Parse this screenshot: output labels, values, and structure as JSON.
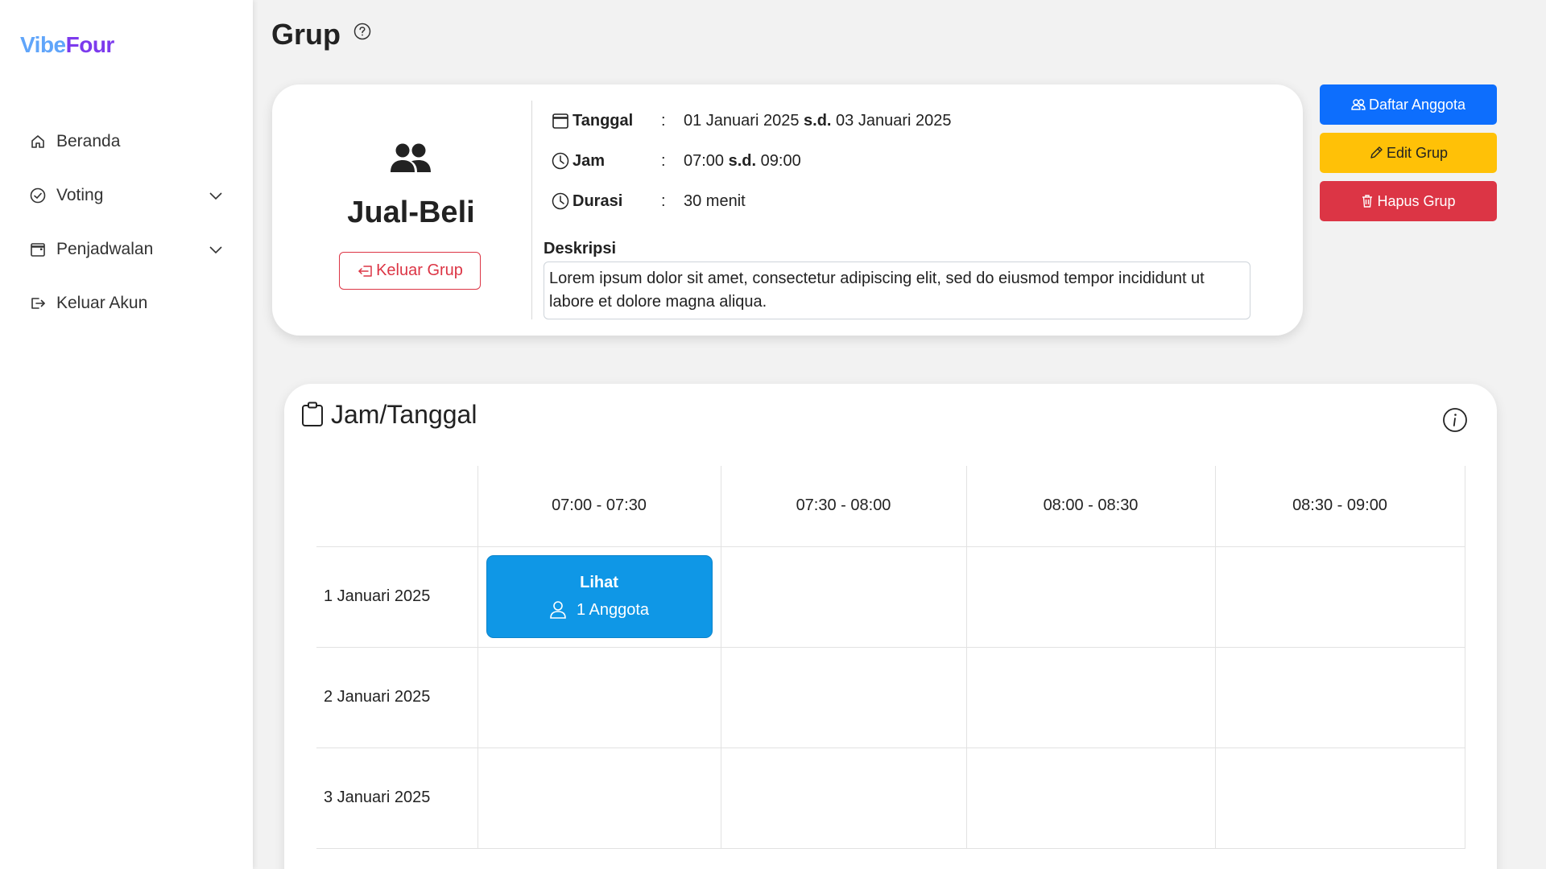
{
  "app": {
    "logo_part1": "Vibe",
    "logo_part2": "Four"
  },
  "sidebar": {
    "items": [
      {
        "label": "Beranda",
        "icon": "home-icon"
      },
      {
        "label": "Voting",
        "icon": "check-circle-icon",
        "has_dropdown": true
      },
      {
        "label": "Penjadwalan",
        "icon": "calendar-icon",
        "has_dropdown": true
      },
      {
        "label": "Keluar Akun",
        "icon": "logout-icon"
      }
    ]
  },
  "page": {
    "title": "Grup",
    "help_icon": "question-circle-icon"
  },
  "group": {
    "name": "Jual-Beli",
    "leave_label": "Keluar Grup",
    "details": {
      "tanggal_label": "Tanggal",
      "tanggal_start": "01 Januari 2025",
      "tanggal_sep": "s.d.",
      "tanggal_end": "03 Januari 2025",
      "jam_label": "Jam",
      "jam_start": "07:00",
      "jam_sep": "s.d.",
      "jam_end": "09:00",
      "durasi_label": "Durasi",
      "durasi_value": "30 menit",
      "colon": ":"
    },
    "description_label": "Deskripsi",
    "description": "Lorem ipsum dolor sit amet, consectetur adipiscing elit, sed do eiusmod tempor incididunt ut labore et dolore magna aliqua."
  },
  "actions": {
    "members_label": "Daftar Anggota",
    "edit_label": "Edit Grup",
    "delete_label": "Hapus Grup"
  },
  "schedule": {
    "title": "Jam/Tanggal",
    "time_slots": [
      "07:00 - 07:30",
      "07:30 - 08:00",
      "08:00 - 08:30",
      "08:30 - 09:00"
    ],
    "dates": [
      "1 Januari 2025",
      "2 Januari 2025",
      "3 Januari 2025"
    ],
    "entry": {
      "view_label": "Lihat",
      "members_label": "1 Anggota"
    }
  },
  "colors": {
    "primary": "#0d6efd",
    "warning": "#ffc107",
    "danger": "#dc3545",
    "slot": "#0f97e6",
    "logo_light": "#60a5fa",
    "logo_dark": "#7c3aed"
  }
}
